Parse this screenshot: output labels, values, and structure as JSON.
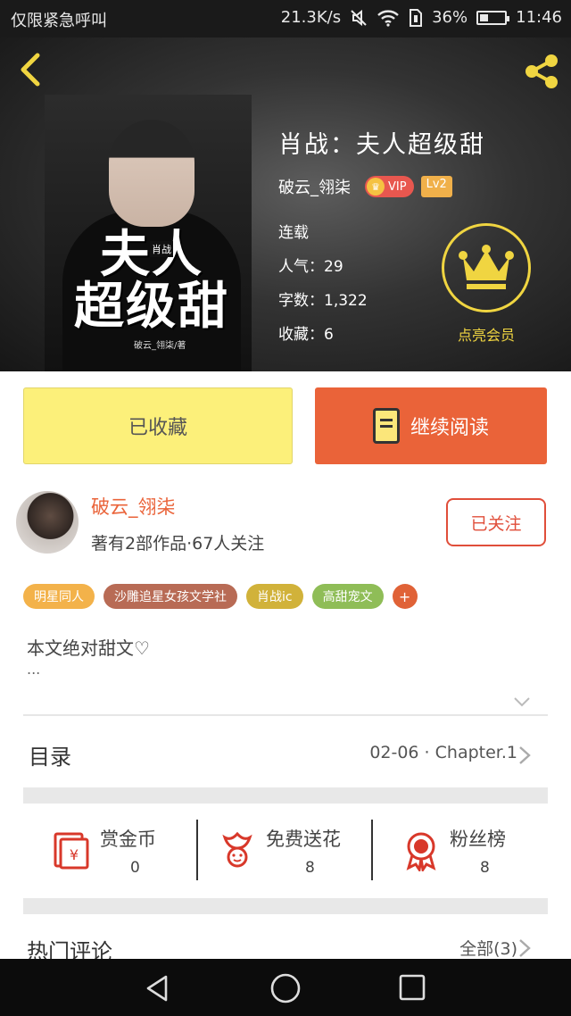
{
  "status_bar": {
    "carrier": "仅限紧急呼叫",
    "speed": "21.3K/s",
    "battery": "36%",
    "battery_level": 0.36,
    "time": "11:46"
  },
  "book": {
    "title": "肖战：夫人超级甜",
    "author": "破云_翎柒",
    "vip_label": "VIP",
    "level_label": "Lv2",
    "status": "连载",
    "popularity": "人气：29",
    "word_count": "字数：1,322",
    "favorites": "收藏：6",
    "cover": {
      "title_line1": "夫人",
      "title_line2": "超级甜",
      "small": "肖战",
      "author": "破云_翎柒/著"
    }
  },
  "member": {
    "label": "点亮会员"
  },
  "actions": {
    "favorited_label": "已收藏",
    "continue_label": "继续阅读"
  },
  "author_card": {
    "name": "破云_翎柒",
    "stats": "著有2部作品·67人关注",
    "follow_label": "已关注"
  },
  "tags": [
    {
      "label": "明星同人",
      "color": "#f3b24a"
    },
    {
      "label": "沙雕追星女孩文学社",
      "color": "#b86b55"
    },
    {
      "label": "肖战ic",
      "color": "#d1b23a"
    },
    {
      "label": "高甜宠文",
      "color": "#8fbd57"
    }
  ],
  "tag_more": "+",
  "intro": {
    "text": "本文绝对甜文♡",
    "ellipsis": "..."
  },
  "toc": {
    "label": "目录",
    "latest": "02-06 · Chapter.1"
  },
  "stats": [
    {
      "label": "赏金币",
      "value": "0",
      "icon": "red-envelope-icon"
    },
    {
      "label": "免费送花",
      "value": "8",
      "icon": "flower-icon"
    },
    {
      "label": "粉丝榜",
      "value": "8",
      "icon": "ribbon-medal-icon"
    }
  ],
  "comments": {
    "label": "热门评论",
    "all": "全部(3)"
  },
  "colors": {
    "accent_orange": "#ea6339",
    "favorite_yellow": "#fcf07a",
    "crown_yellow": "#f0d541",
    "follow_red": "#e04e3a"
  }
}
